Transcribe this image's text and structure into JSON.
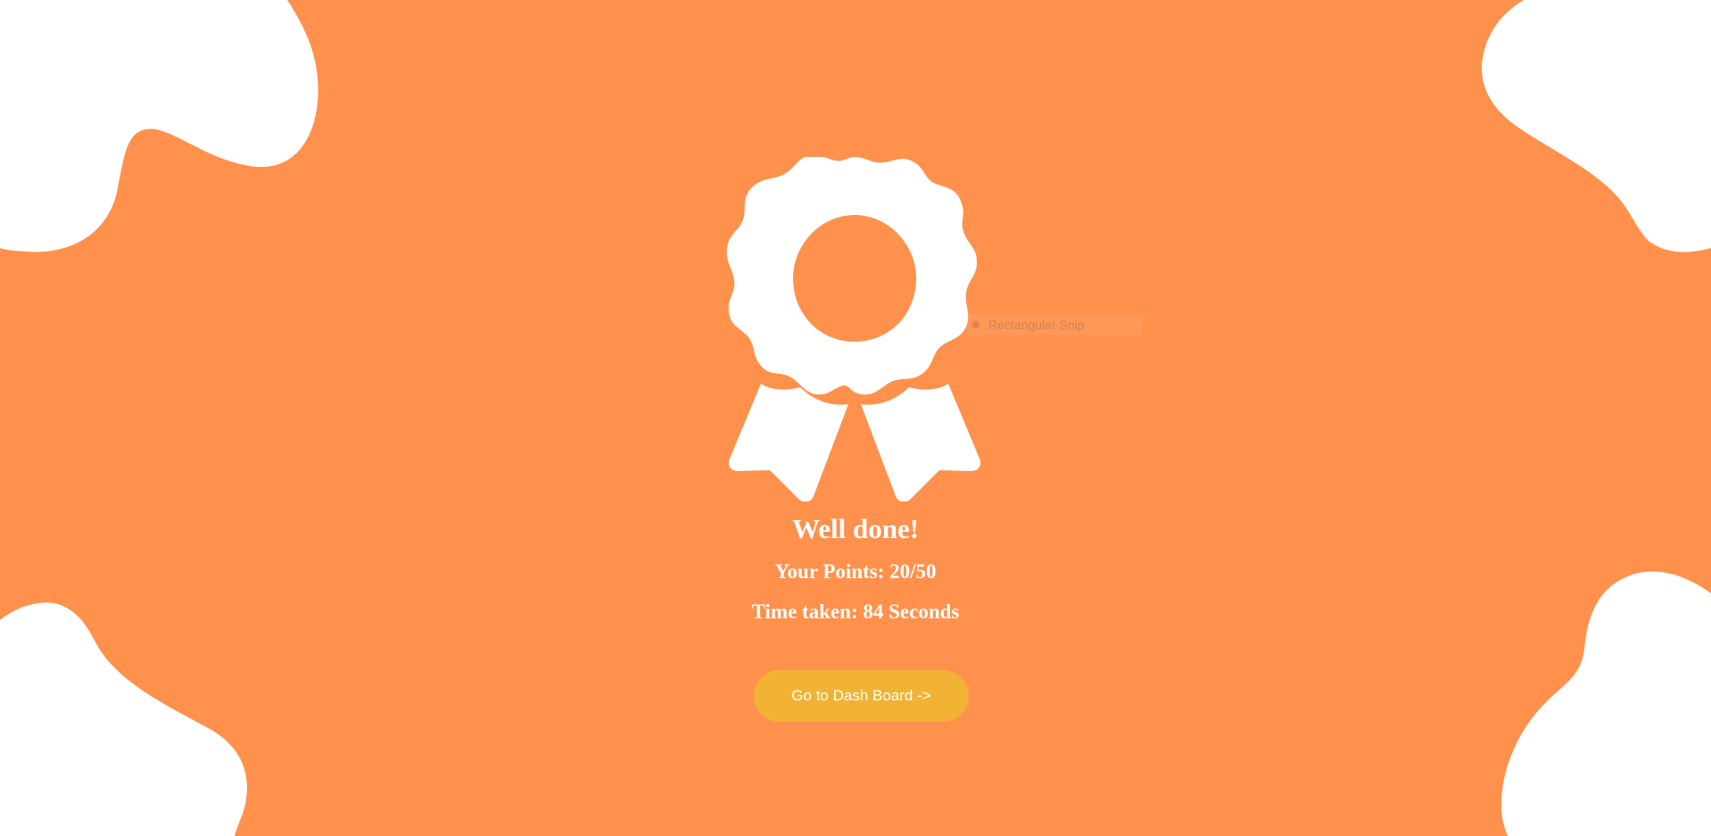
{
  "page": {
    "background_color": "#ff914d",
    "blob_color": "#ffffff"
  },
  "badge": {
    "icon": "award-ribbon-icon",
    "color": "#ffffff"
  },
  "result": {
    "title": "Well done!",
    "points_text": "Your Points: 20/50",
    "time_text": "Time taken: 84 Seconds"
  },
  "actions": {
    "dashboard_label": "Go to Dash Board ->",
    "dashboard_color": "#f2b233"
  },
  "overlay": {
    "snip_label": "Rectangular Snip",
    "icon": "snip-record-icon"
  }
}
